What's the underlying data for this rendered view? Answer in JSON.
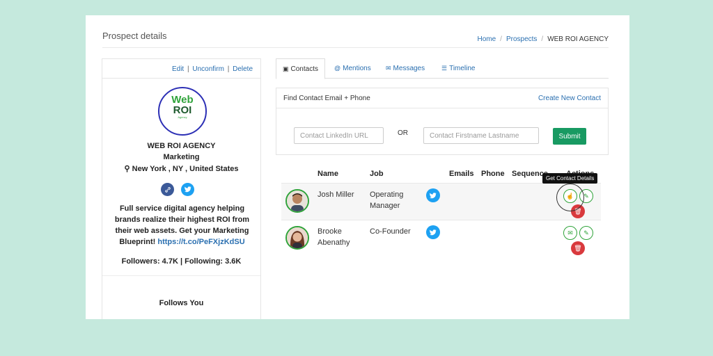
{
  "page": {
    "title": "Prospect details"
  },
  "breadcrumb": {
    "home": "Home",
    "prospects": "Prospects",
    "current": "WEB ROI AGENCY"
  },
  "left_panel": {
    "actions": {
      "edit": "Edit",
      "unconfirm": "Unconfirm",
      "delete": "Delete"
    },
    "logo": {
      "line1": "Web",
      "line2": "ROI",
      "line3": "Agency"
    },
    "company_name": "WEB ROI AGENCY",
    "department": "Marketing",
    "location": "New York , NY , United States",
    "social_icons": [
      "link-icon",
      "twitter-icon"
    ],
    "bio": "Full service digital agency helping brands realize their highest ROI from their web assets. Get your Marketing Blueprint!",
    "bio_link": "https://t.co/PeFXjzKdSU",
    "stats": "Followers: 4.7K | Following: 3.6K",
    "follows": "Follows You"
  },
  "tabs": [
    {
      "label": "Contacts",
      "icon": "contact-card-icon",
      "active": true
    },
    {
      "label": "Mentions",
      "icon": "at-icon",
      "active": false
    },
    {
      "label": "Messages",
      "icon": "envelope-icon",
      "active": false
    },
    {
      "label": "Timeline",
      "icon": "list-icon",
      "active": false
    }
  ],
  "find_contact": {
    "title": "Find Contact Email + Phone",
    "create_link": "Create New Contact",
    "linkedin_placeholder": "Contact LinkedIn URL",
    "or_label": "OR",
    "name_placeholder": "Contact Firstname Lastname",
    "submit_label": "Submit"
  },
  "table": {
    "columns": [
      "Name",
      "Job",
      "Emails",
      "Phone",
      "Sequence",
      "Actions"
    ],
    "rows": [
      {
        "name": "Josh Miller",
        "job": "Operating Manager"
      },
      {
        "name": "Brooke Abenathy",
        "job": "Co-Founder"
      }
    ]
  },
  "tooltip": "Get Contact Details",
  "colors": {
    "background": "#c5e9dd",
    "link": "#2a6fb0",
    "submit": "#189a62",
    "twitter": "#1da1f2",
    "delete": "#d9393d",
    "accent_green": "#2fa33a"
  }
}
